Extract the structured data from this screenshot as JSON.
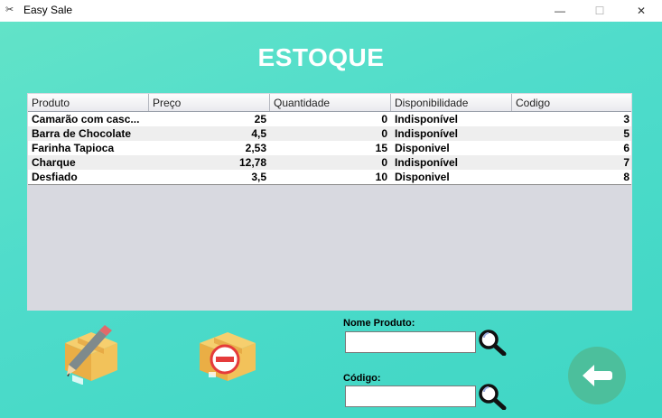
{
  "window": {
    "title": "Easy Sale",
    "app_icon": "✂",
    "minimize": "—",
    "maximize": "☐",
    "close": "✕"
  },
  "page": {
    "title": "ESTOQUE"
  },
  "table": {
    "columns": [
      "Produto",
      "Preço",
      "Quantidade",
      "Disponibilidade",
      "Codigo"
    ],
    "rows": [
      [
        "Camarão com casc...",
        "25",
        "0",
        "Indisponível",
        "3"
      ],
      [
        "Barra de Chocolate",
        "4,5",
        "0",
        "Indisponível",
        "5"
      ],
      [
        "Farinha Tapioca",
        "2,53",
        "15",
        "Disponivel",
        "6"
      ],
      [
        "Charque",
        "12,78",
        "0",
        "Indisponível",
        "7"
      ],
      [
        "Desfiado",
        "3,5",
        "10",
        "Disponivel",
        "8"
      ]
    ]
  },
  "search": {
    "nome_label": "Nome Produto:",
    "nome_value": "",
    "codigo_label": "Código:",
    "codigo_value": ""
  },
  "icons": {
    "edit": "box-pencil-icon",
    "remove": "box-remove-icon",
    "search": "magnifier-icon",
    "back": "arrow-left-icon"
  },
  "colors": {
    "background_top": "#62e3c8",
    "background_bottom": "#3fd6c4",
    "back_button": "#4cbf9c",
    "table_empty_area": "#d8d9e0"
  }
}
